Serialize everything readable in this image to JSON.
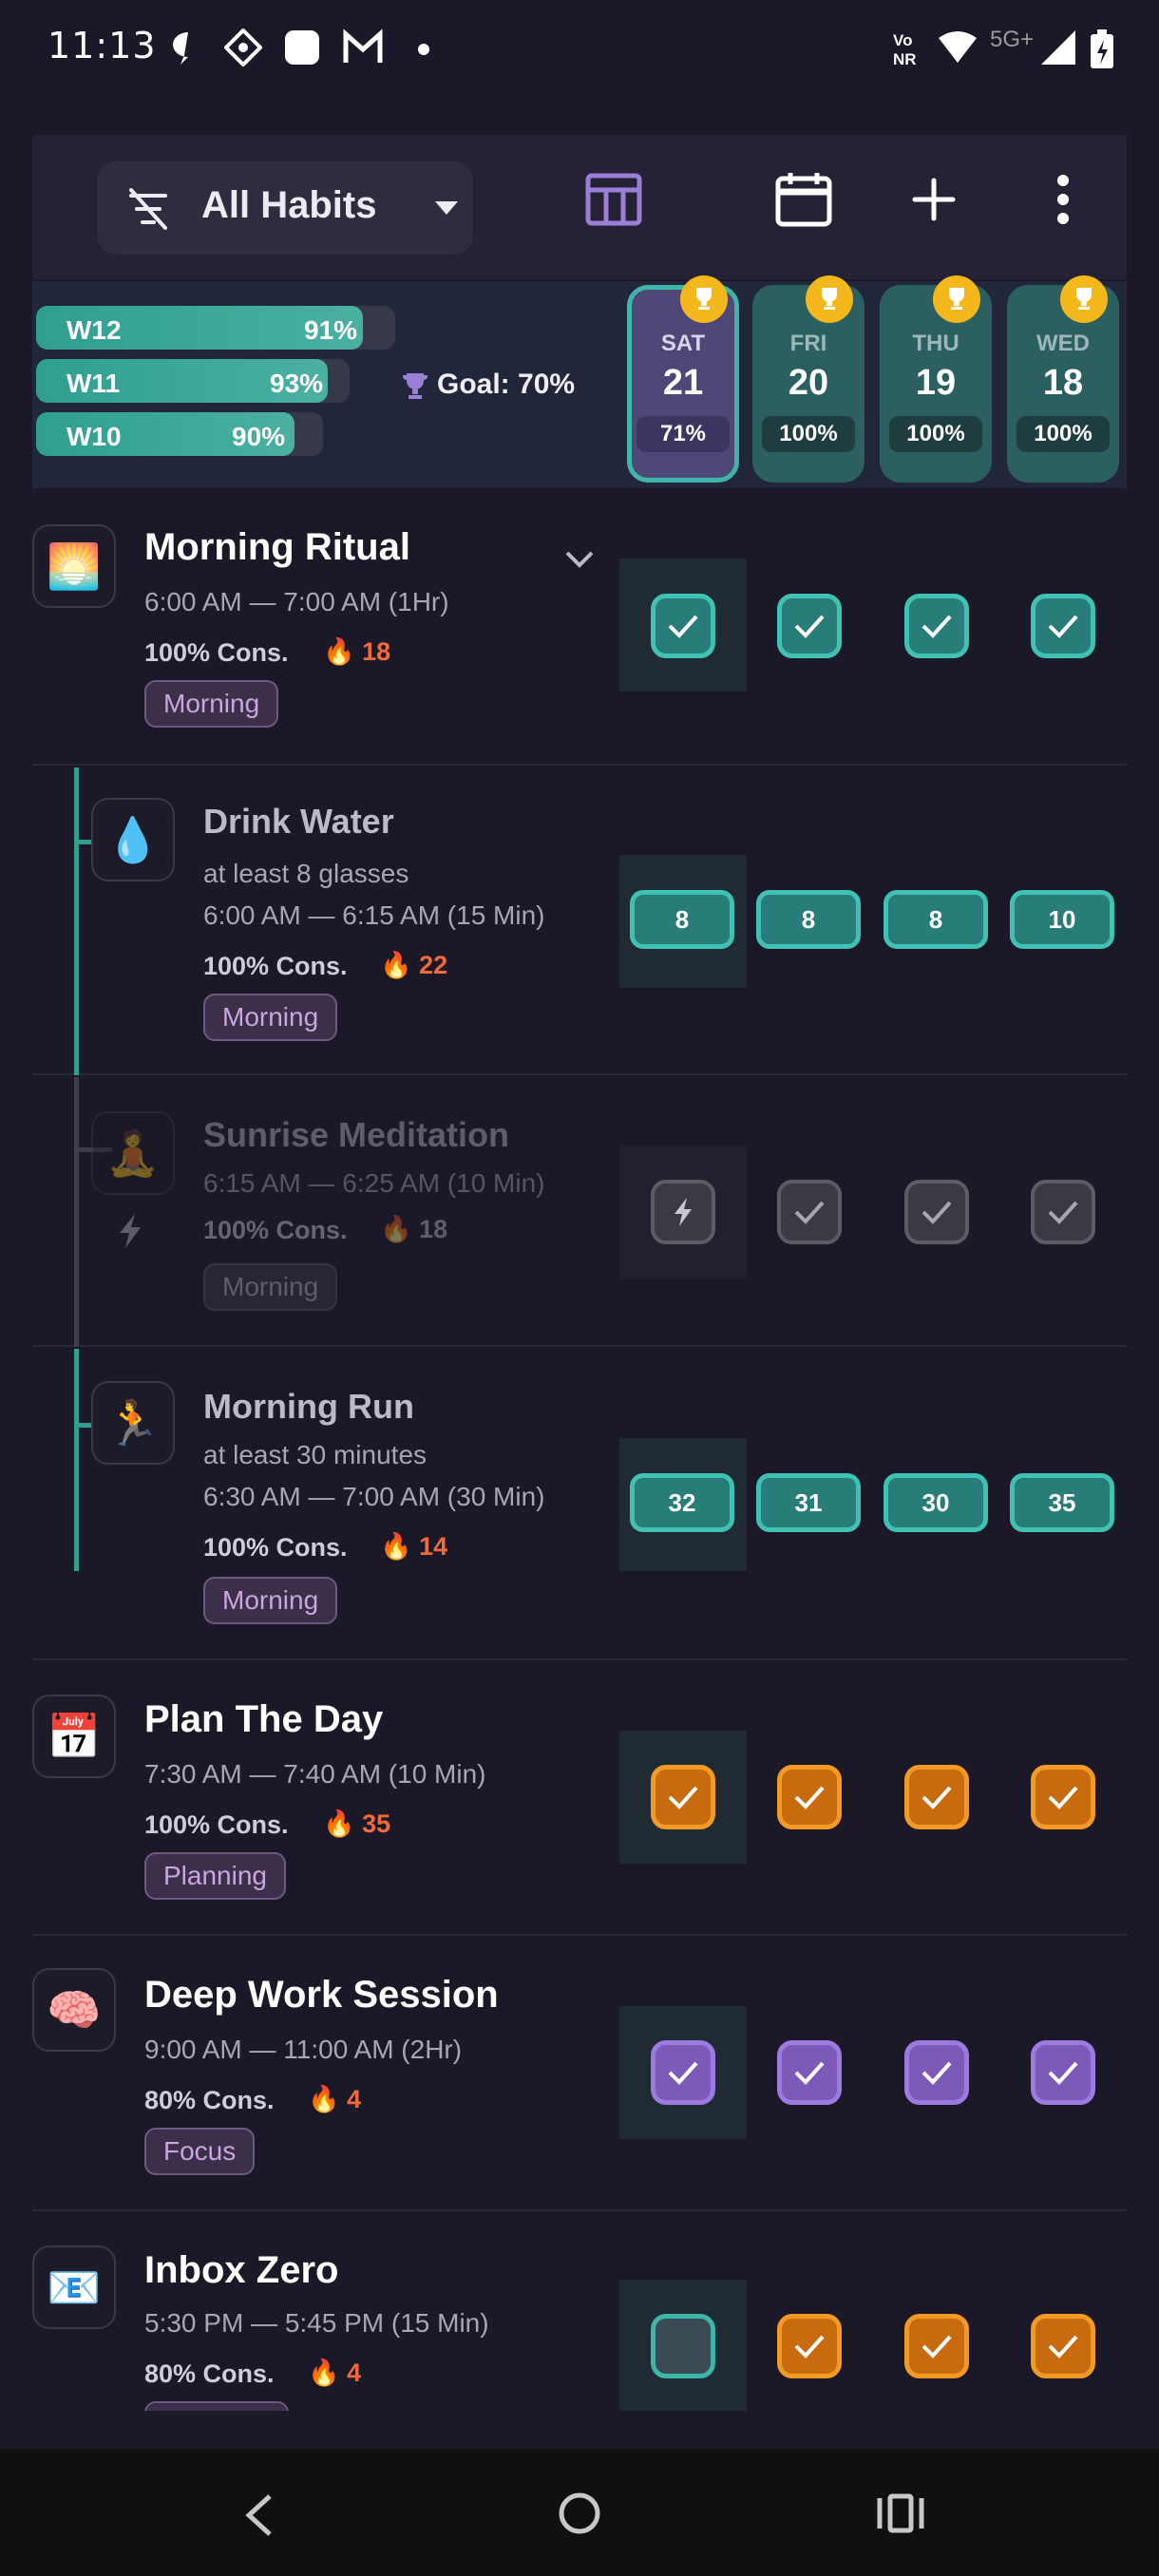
{
  "status_bar": {
    "time": "11:13",
    "network": "5G+"
  },
  "toolbar": {
    "filter_label": "All Habits"
  },
  "weeks": [
    {
      "label": "W12",
      "percent": "91%",
      "fill": 0.91
    },
    {
      "label": "W11",
      "percent": "93%",
      "fill": 0.93
    },
    {
      "label": "W10",
      "percent": "90%",
      "fill": 0.9
    }
  ],
  "goal": "Goal: 70%",
  "days": [
    {
      "name": "SAT",
      "date": "21",
      "percent": "71%"
    },
    {
      "name": "FRI",
      "date": "20",
      "percent": "100%"
    },
    {
      "name": "THU",
      "date": "19",
      "percent": "100%"
    },
    {
      "name": "WED",
      "date": "18",
      "percent": "100%"
    }
  ],
  "habits": [
    {
      "icon": "sunrise-icon",
      "emoji": "🌅",
      "title": "Morning Ritual",
      "time": "6:00 AM — 7:00 AM (1Hr)",
      "cons": "100% Cons.",
      "streak": "18",
      "tag": "Morning"
    },
    {
      "icon": "water-drop-icon",
      "emoji": "💧",
      "title": "Drink Water",
      "sub": "at least 8 glasses",
      "time": "6:00 AM — 6:15 AM (15 Min)",
      "cons": "100% Cons.",
      "streak": "22",
      "tag": "Morning",
      "values": [
        "8",
        "8",
        "8",
        "10"
      ]
    },
    {
      "icon": "meditation-icon",
      "emoji": "🧘",
      "title": "Sunrise Meditation",
      "time": "6:15 AM — 6:25 AM (10 Min)",
      "cons": "100% Cons.",
      "streak": "18",
      "tag": "Morning"
    },
    {
      "icon": "running-icon",
      "emoji": "🏃",
      "title": "Morning Run",
      "sub": "at least 30 minutes",
      "time": "6:30 AM — 7:00 AM (30 Min)",
      "cons": "100% Cons.",
      "streak": "14",
      "tag": "Morning",
      "values": [
        "32",
        "31",
        "30",
        "35"
      ]
    },
    {
      "icon": "calendar-icon",
      "emoji": "📅",
      "title": "Plan The Day",
      "time": "7:30 AM — 7:40 AM (10 Min)",
      "cons": "100% Cons.",
      "streak": "35",
      "tag": "Planning"
    },
    {
      "icon": "brain-icon",
      "emoji": "🧠",
      "title": "Deep Work Session",
      "time": "9:00 AM — 11:00 AM (2Hr)",
      "cons": "80% Cons.",
      "streak": "4",
      "tag": "Focus"
    },
    {
      "icon": "email-icon",
      "emoji": "📧",
      "title": "Inbox Zero",
      "time": "5:30 PM — 5:45 PM (15 Min)",
      "cons": "80% Cons.",
      "streak": "4",
      "tag": ""
    }
  ],
  "colors": {
    "background": "#1b1827",
    "teal": "#3fc2b4",
    "orange": "#f29a25",
    "purple": "#9c7be0",
    "tag_text": "#c9a6dd",
    "streak": "#f06a3c",
    "trophy": "#f5b81c"
  }
}
